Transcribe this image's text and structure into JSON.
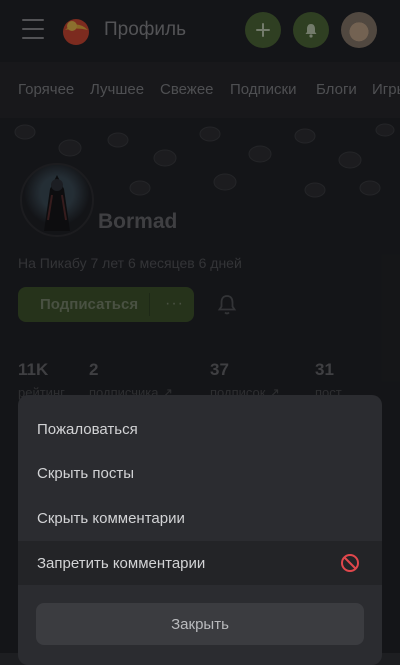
{
  "header": {
    "title": "Профиль",
    "icons": [
      "menu-icon",
      "logo-icon",
      "plus-icon",
      "bell-icon",
      "user-avatar"
    ],
    "accent": "#4d6b33"
  },
  "tabs": [
    "Горячее",
    "Лучшее",
    "Свежее",
    "Подписки",
    "Блоги",
    "Игры"
  ],
  "profile": {
    "username": "Bormad",
    "joined": "На Пикабу 7 лет 6 месяцев 6 дней",
    "subscribe_label": "Подписаться",
    "more_label": "···",
    "stats": [
      {
        "value": "11K",
        "label": "рейтинг"
      },
      {
        "value": "2",
        "label": "подписчика ↗"
      },
      {
        "value": "37",
        "label": "подписок ↗"
      },
      {
        "value": "31",
        "label": "пост"
      }
    ]
  },
  "sheet": {
    "items": [
      {
        "label": "Пожаловаться"
      },
      {
        "label": "Скрыть посты"
      },
      {
        "label": "Скрыть комментарии"
      },
      {
        "label": "Запретить комментарии",
        "icon": "ban-icon",
        "icon_color": "#e0474c"
      }
    ],
    "close_label": "Закрыть"
  }
}
